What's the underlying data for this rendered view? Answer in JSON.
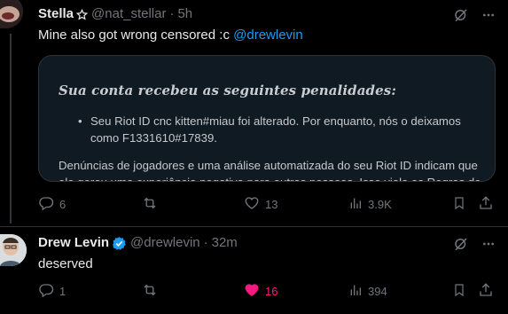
{
  "posts": [
    {
      "author": {
        "name": "Stella",
        "handle": "@nat_stellar",
        "time": "5h"
      },
      "text": "Mine also got wrong censored :c ",
      "mention": "@drewlevin",
      "media": {
        "title": "Sua conta recebeu as seguintes penalidades:",
        "bullet": "Seu Riot ID cnc kitten#miau foi alterado. Por enquanto, nós o deixamos como F1331610#17839.",
        "body": "Denúncias de jogadores e uma análise automatizada do seu Riot ID indicam que ele gerou uma experiência negativa para outras pessoas. Isso viola as Regras de"
      },
      "stats": {
        "replies": "6",
        "reposts": "",
        "likes": "13",
        "views": "3.9K"
      }
    },
    {
      "author": {
        "name": "Drew Levin",
        "handle": "@drewlevin",
        "time": "32m"
      },
      "text": "deserved",
      "stats": {
        "replies": "1",
        "reposts": "",
        "likes": "16",
        "views": "394"
      }
    }
  ],
  "colors": {
    "accent": "#1d9bf0",
    "like": "#f91880",
    "muted": "#71767b",
    "text": "#e7e9ea",
    "verified": "#1d9bf0"
  },
  "icons": [
    "star-icon",
    "verified-badge-icon",
    "grok-icon",
    "more-icon",
    "reply-icon",
    "repost-icon",
    "like-icon",
    "views-icon",
    "bookmark-icon",
    "share-icon"
  ]
}
